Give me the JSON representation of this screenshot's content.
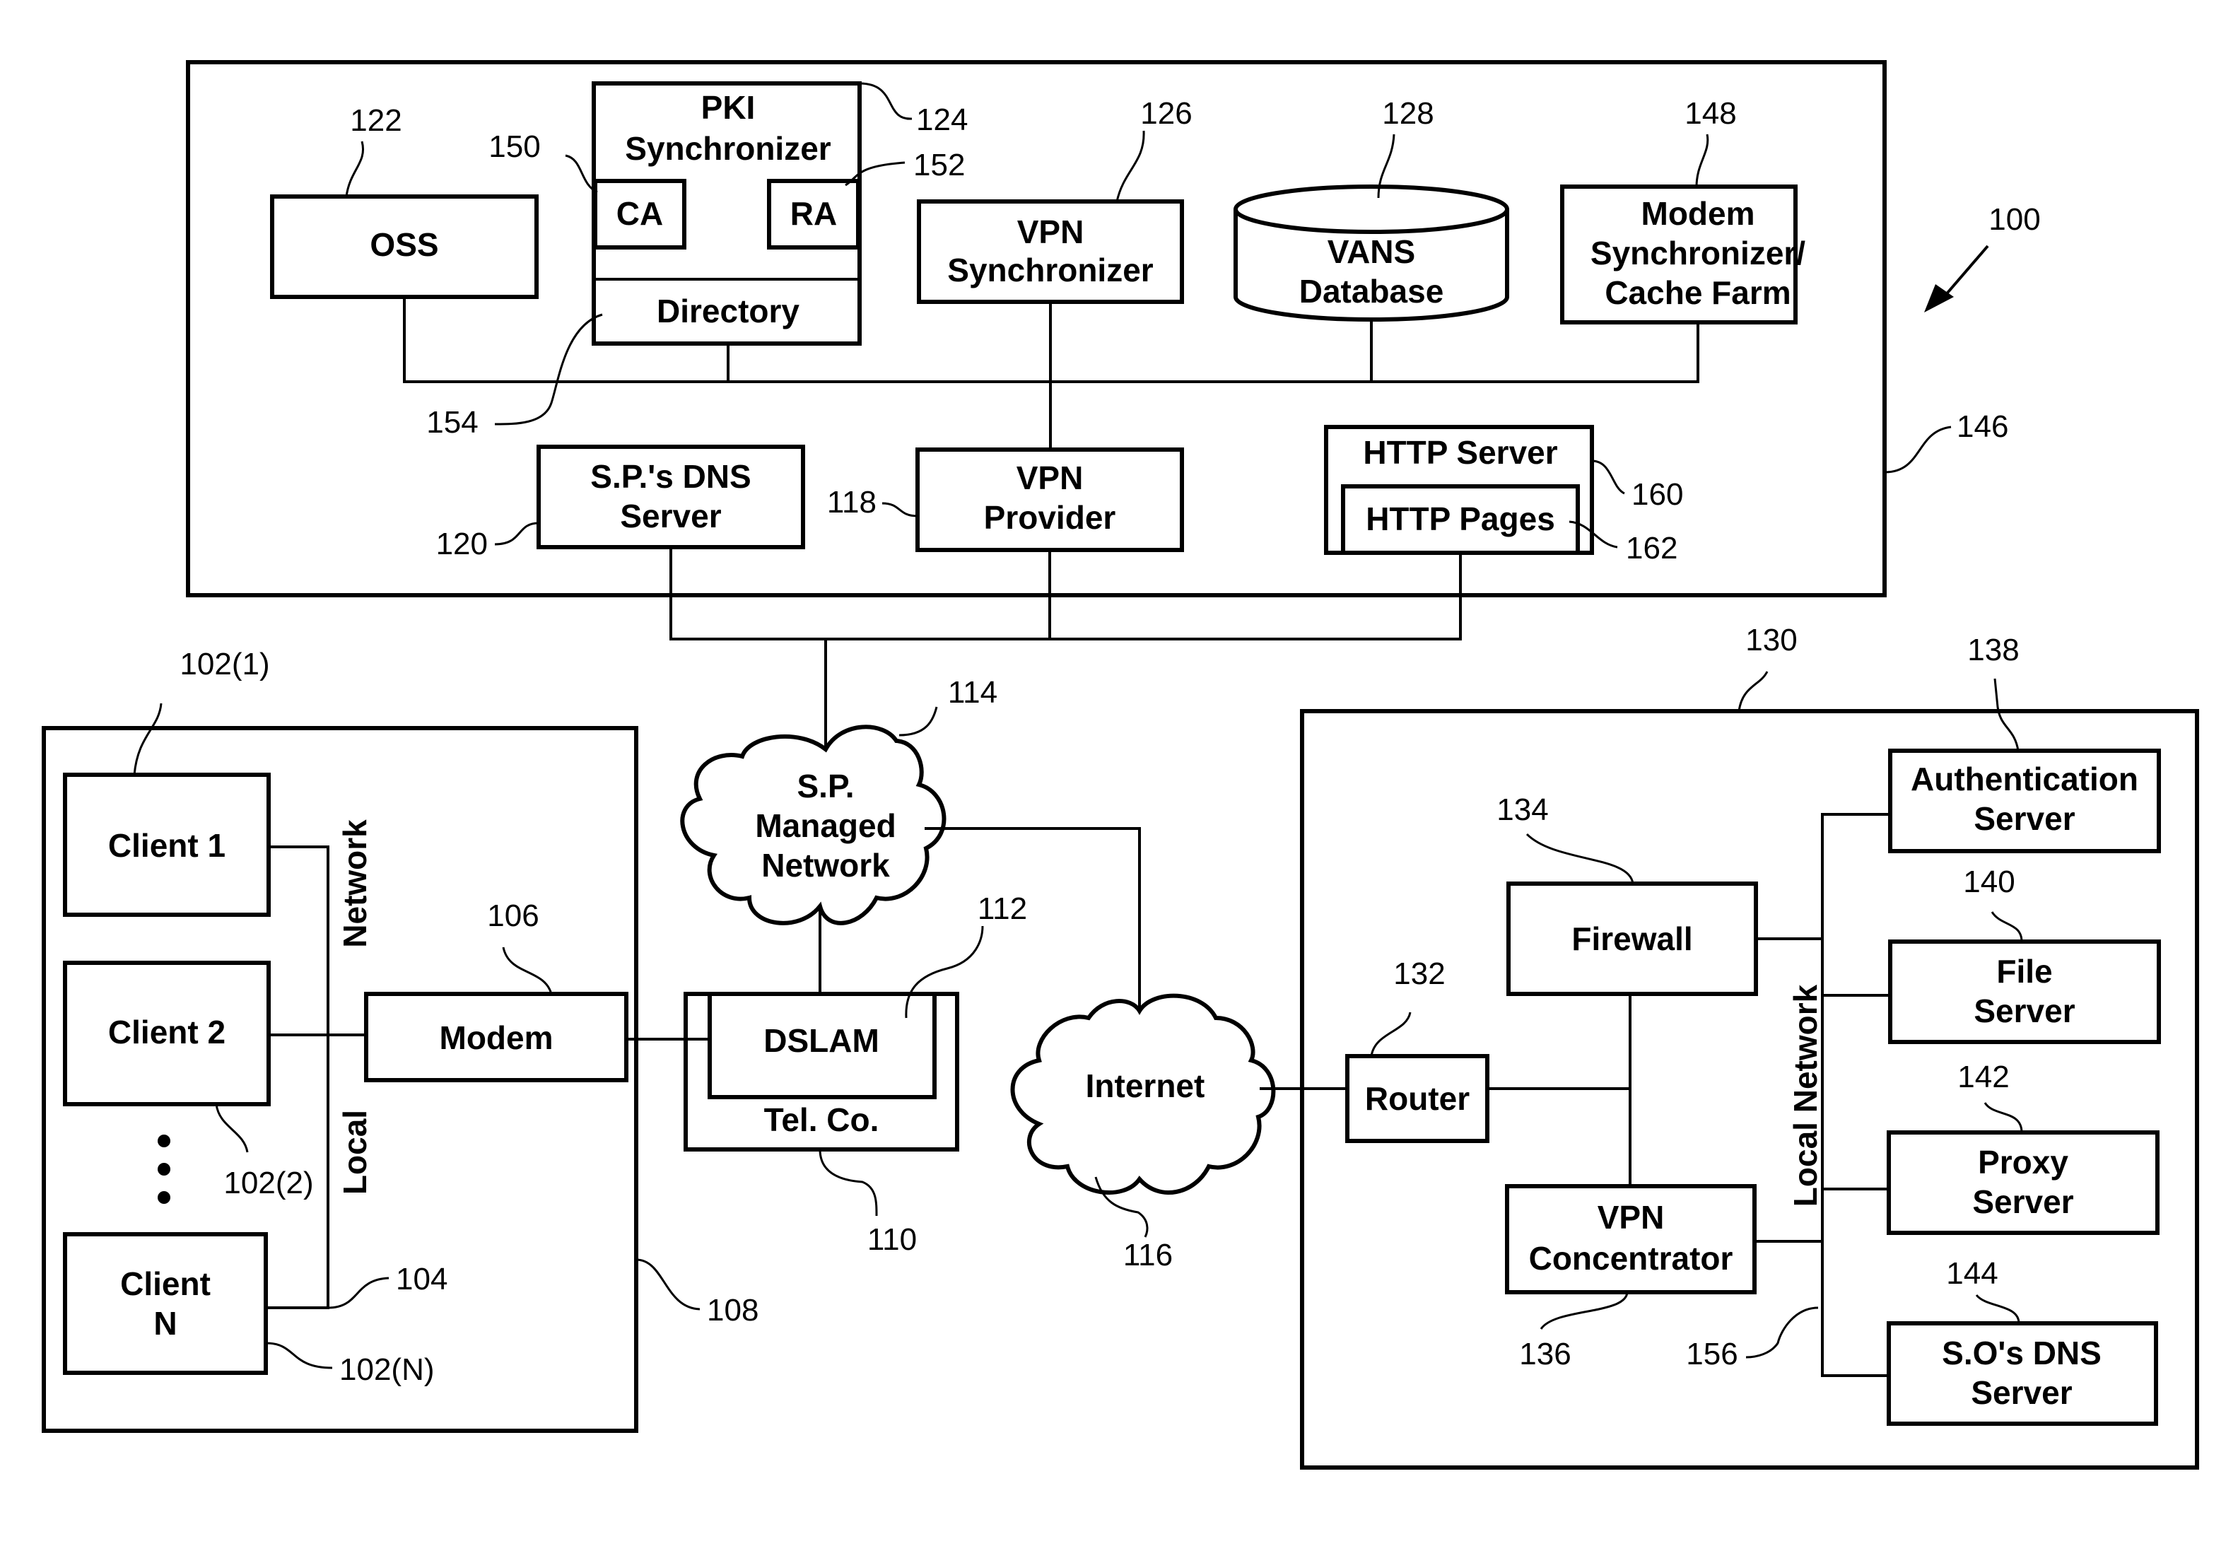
{
  "figure": {
    "ref": "100",
    "service_provider": {
      "ref": "146",
      "oss": {
        "label": "OSS",
        "ref": "122"
      },
      "pki": {
        "title": [
          "PKI",
          "Synchronizer"
        ],
        "ref": "124",
        "ca": {
          "label": "CA",
          "ref": "150"
        },
        "ra": {
          "label": "RA",
          "ref": "152"
        },
        "directory": {
          "label": "Directory",
          "ref": "154"
        }
      },
      "vpn_sync": {
        "lines": [
          "VPN",
          "Synchronizer"
        ],
        "ref": "126"
      },
      "vans_db": {
        "lines": [
          "VANS",
          "Database"
        ],
        "ref": "128"
      },
      "modem_sync": {
        "lines": [
          "Modem",
          "Synchronizer/",
          "Cache Farm"
        ],
        "ref": "148"
      },
      "dns": {
        "lines": [
          "S.P.'s DNS",
          "Server"
        ],
        "ref": "120"
      },
      "vpn_provider": {
        "lines": [
          "VPN",
          "Provider"
        ],
        "ref": "118"
      },
      "http_server": {
        "label": "HTTP Server",
        "ref": "160",
        "pages": {
          "label": "HTTP Pages",
          "ref": "162"
        }
      }
    },
    "sp_network": {
      "lines": [
        "S.P.",
        "Managed",
        "Network"
      ],
      "ref": "114"
    },
    "client_site": {
      "ref": "108",
      "clients": [
        {
          "lines": [
            "Client 1"
          ],
          "ref": "102(1)"
        },
        {
          "lines": [
            "Client  2"
          ],
          "ref": "102(2)"
        },
        {
          "lines": [
            "Client",
            "N"
          ],
          "ref": "102(N)"
        }
      ],
      "local_network": {
        "word1": "Local",
        "word2": "Network",
        "ref": "104"
      },
      "modem": {
        "label": "Modem",
        "ref": "106"
      }
    },
    "telco": {
      "label": "Tel. Co.",
      "ref": "110",
      "dslam": {
        "label": "DSLAM",
        "ref": "112"
      }
    },
    "internet": {
      "label": "Internet",
      "ref": "116"
    },
    "office": {
      "ref": "130",
      "router": {
        "label": "Router",
        "ref": "132"
      },
      "firewall": {
        "label": "Firewall",
        "ref": "134"
      },
      "vpn_conc": {
        "lines": [
          "VPN",
          "Concentrator"
        ],
        "ref": "136"
      },
      "local_network": {
        "label": "Local Network",
        "ref": "156"
      },
      "auth": {
        "lines": [
          "Authentication",
          "Server"
        ],
        "ref": "138"
      },
      "file": {
        "lines": [
          "File",
          "Server"
        ],
        "ref": "140"
      },
      "proxy": {
        "lines": [
          "Proxy",
          "Server"
        ],
        "ref": "142"
      },
      "dns": {
        "lines": [
          "S.O's DNS",
          "Server"
        ],
        "ref": "144"
      }
    }
  }
}
